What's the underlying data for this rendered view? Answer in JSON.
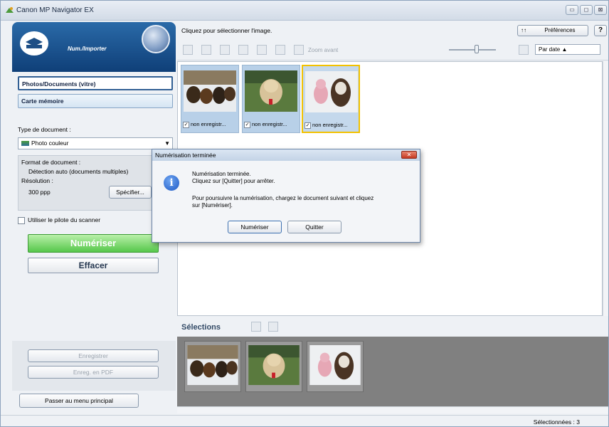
{
  "window": {
    "title": "Canon MP Navigator EX",
    "min": "▭",
    "max": "◻",
    "close": "⊠"
  },
  "left": {
    "header_label": "Num./Importer",
    "nav": [
      "Photos/Documents (vitre)",
      "Carte mémoire"
    ],
    "doc_type_label": "Type de document :",
    "doc_type_value": "Photo couleur",
    "format_label": "Format de document :",
    "format_value": "Détection auto (documents multiples)",
    "resolution_label": "Résolution :",
    "resolution_value": "300 ppp",
    "specify_button": "Spécifier...",
    "driver_checkbox": "Utiliser le pilote du scanner",
    "scan_button": "Numériser",
    "clear_button": "Effacer",
    "save_button": "Enregistrer",
    "save_pdf_button": "Enreg. en PDF",
    "main_menu_button": "Passer au menu principal"
  },
  "right": {
    "hint": "Cliquez pour sélectionner l'image.",
    "prefs_button": "Préférences",
    "help_button": "?",
    "prefs_icon": "↑↑",
    "zoom_label": "Zoom avant",
    "sort_value": "Par date ▲",
    "thumbnails": [
      "non enregistr...",
      "non enregistr...",
      "non enregistr..."
    ],
    "selections_label": "Sélections"
  },
  "status": {
    "selected": "Sélectionnées : 3"
  },
  "dialog": {
    "title": "Numérisation terminée",
    "line1": "Numérisation terminée.",
    "line2": "Cliquez sur [Quitter] pour arrêter.",
    "line3": "Pour poursuivre la numérisation, chargez le document suivant et cliquez",
    "line4": "sur [Numériser].",
    "scan_button": "Numériser",
    "quit_button": "Quitter",
    "close_icon": "✕"
  }
}
